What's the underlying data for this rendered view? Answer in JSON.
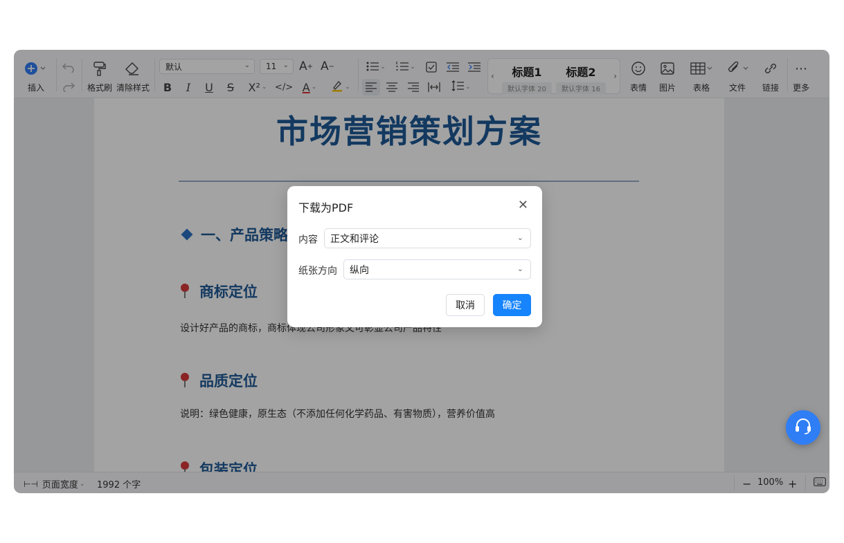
{
  "toolbar": {
    "insert_label": "插入",
    "format_painter_label": "格式刷",
    "clear_format_label": "清除样式",
    "font_family_value": "默认",
    "font_size_value": "11",
    "bold": "B",
    "italic": "I",
    "underline": "U",
    "strikethrough": "S",
    "superscript": "X²",
    "code": "</>",
    "font_color": "A",
    "headings": [
      {
        "title": "标题1",
        "sub": "默认字体 20"
      },
      {
        "title": "标题2",
        "sub": "默认字体 16"
      }
    ],
    "emoji_label": "表情",
    "image_label": "图片",
    "table_label": "表格",
    "file_label": "文件",
    "link_label": "链接",
    "more_label": "更多",
    "accent_color": "#2f7ef5"
  },
  "document": {
    "title": "市场营销策划方案",
    "section1": "一、产品策略",
    "sub1": "商标定位",
    "para1": "设计好产品的商标，商标体现公司形象又可彰显公司产品特性",
    "sub2": "品质定位",
    "para2": "说明：绿色健康，原生态（不添加任何化学药品、有害物质），营养价值高",
    "sub3": "包装定位"
  },
  "statusbar": {
    "page_width_label": "页面宽度",
    "word_count": "1992 个字",
    "zoom": "100%"
  },
  "dialog": {
    "title": "下载为PDF",
    "content_label": "内容",
    "content_value": "正文和评论",
    "orientation_label": "纸张方向",
    "orientation_value": "纵向",
    "cancel_label": "取消",
    "ok_label": "确定",
    "ok_color": "#1684fc"
  }
}
